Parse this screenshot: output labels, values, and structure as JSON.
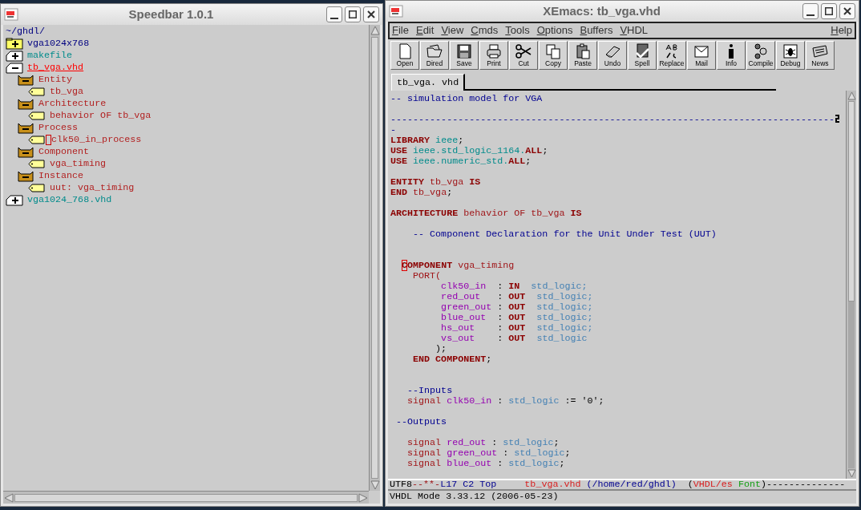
{
  "speedbar": {
    "title": "Speedbar 1.0.1",
    "path": "~/ghdl/",
    "items": [
      {
        "kind": "folder",
        "label": "vga1024x768",
        "expanded": false,
        "selected": false
      },
      {
        "kind": "file",
        "label": "makefile",
        "expanded": false,
        "selected": false
      },
      {
        "kind": "file",
        "label": "tb_vga.vhd",
        "expanded": true,
        "selected": true,
        "children": [
          {
            "kind": "group",
            "label": "Entity",
            "children": [
              {
                "kind": "tag",
                "label": "tb_vga",
                "cursor": false
              }
            ]
          },
          {
            "kind": "group",
            "label": "Architecture",
            "children": [
              {
                "kind": "tag",
                "label": "behavior OF tb_vga",
                "cursor": false
              }
            ]
          },
          {
            "kind": "group",
            "label": "Process",
            "children": [
              {
                "kind": "tag",
                "label": "clk50_in_process",
                "cursor": true
              }
            ]
          },
          {
            "kind": "group",
            "label": "Component",
            "children": [
              {
                "kind": "tag",
                "label": "vga_timing",
                "cursor": false
              }
            ]
          },
          {
            "kind": "group",
            "label": "Instance",
            "children": [
              {
                "kind": "tag",
                "label": "uut: vga_timing",
                "cursor": false
              }
            ]
          }
        ]
      },
      {
        "kind": "file",
        "label": "vga1024_768.vhd",
        "expanded": false,
        "selected": false
      }
    ]
  },
  "editor": {
    "title": "XEmacs: tb_vga.vhd",
    "menu": [
      "File",
      "Edit",
      "View",
      "Cmds",
      "Tools",
      "Options",
      "Buffers",
      "VHDL"
    ],
    "help_menu": "Help",
    "toolbar": [
      "Open",
      "Dired",
      "Save",
      "Print",
      "Cut",
      "Copy",
      "Paste",
      "Undo",
      "Spell",
      "Replace",
      "Mail",
      "Info",
      "Compile",
      "Debug",
      "News"
    ],
    "tabs": [
      {
        "label": "tb_vga. vhd",
        "selected": true
      }
    ],
    "code": [
      {
        "kind": "code",
        "segments": [
          {
            "text": "-- simulation model for VGA",
            "kind": "comment"
          }
        ]
      },
      {
        "kind": "blank"
      },
      {
        "kind": "code",
        "wrapped": true,
        "segments": [
          {
            "text": "-------------------------------------------------------------------------------",
            "kind": "comment"
          }
        ]
      },
      {
        "kind": "code",
        "segments": [
          {
            "text": "-",
            "kind": "comment"
          }
        ]
      },
      {
        "kind": "code",
        "segments": [
          {
            "text": "LIBRARY",
            "kind": "kw"
          },
          {
            "text": " ieee",
            "kind": "lib"
          },
          {
            "text": ";",
            "kind": "plain"
          }
        ]
      },
      {
        "kind": "code",
        "segments": [
          {
            "text": "USE",
            "kind": "kw"
          },
          {
            "text": " ieee.std_logic_1164.",
            "kind": "lib"
          },
          {
            "text": "ALL",
            "kind": "kw"
          },
          {
            "text": ";",
            "kind": "plain"
          }
        ]
      },
      {
        "kind": "code",
        "segments": [
          {
            "text": "USE",
            "kind": "kw"
          },
          {
            "text": " ieee.numeric_std.",
            "kind": "lib"
          },
          {
            "text": "ALL",
            "kind": "kw"
          },
          {
            "text": ";",
            "kind": "plain"
          }
        ]
      },
      {
        "kind": "blank"
      },
      {
        "kind": "code",
        "segments": [
          {
            "text": "ENTITY",
            "kind": "kw"
          },
          {
            "text": " tb_vga ",
            "kind": "id"
          },
          {
            "text": "IS",
            "kind": "kw"
          }
        ]
      },
      {
        "kind": "code",
        "segments": [
          {
            "text": "END",
            "kind": "kw"
          },
          {
            "text": " tb_vga",
            "kind": "id"
          },
          {
            "text": ";",
            "kind": "plain"
          }
        ]
      },
      {
        "kind": "blank"
      },
      {
        "kind": "code",
        "segments": [
          {
            "text": "ARCHITECTURE",
            "kind": "kw"
          },
          {
            "text": " behavior OF tb_vga ",
            "kind": "id"
          },
          {
            "text": "IS",
            "kind": "kw"
          }
        ]
      },
      {
        "kind": "blank"
      },
      {
        "kind": "code",
        "segments": [
          {
            "text": "    -- Component Declaration for the Unit Under Test (UUT)",
            "kind": "comment"
          }
        ]
      },
      {
        "kind": "blank"
      },
      {
        "kind": "blank"
      },
      {
        "kind": "code",
        "segments": [
          {
            "text": "  COMPONENT",
            "kind": "kw",
            "cursor": true
          },
          {
            "text": " vga_timing",
            "kind": "id"
          }
        ]
      },
      {
        "kind": "code",
        "segments": [
          {
            "text": "    PORT(",
            "kind": "id"
          }
        ]
      },
      {
        "kind": "code",
        "segments": [
          {
            "text": "         clk50_in",
            "kind": "sig"
          },
          {
            "text": "  : ",
            "kind": "plain"
          },
          {
            "text": "IN",
            "kind": "kw"
          },
          {
            "text": "  std_logic;",
            "kind": "type"
          }
        ]
      },
      {
        "kind": "code",
        "segments": [
          {
            "text": "         red_out",
            "kind": "sig"
          },
          {
            "text": "   : ",
            "kind": "plain"
          },
          {
            "text": "OUT",
            "kind": "kw"
          },
          {
            "text": "  std_logic;",
            "kind": "type"
          }
        ]
      },
      {
        "kind": "code",
        "segments": [
          {
            "text": "         green_out",
            "kind": "sig"
          },
          {
            "text": " : ",
            "kind": "plain"
          },
          {
            "text": "OUT",
            "kind": "kw"
          },
          {
            "text": "  std_logic;",
            "kind": "type"
          }
        ]
      },
      {
        "kind": "code",
        "segments": [
          {
            "text": "         blue_out",
            "kind": "sig"
          },
          {
            "text": "  : ",
            "kind": "plain"
          },
          {
            "text": "OUT",
            "kind": "kw"
          },
          {
            "text": "  std_logic;",
            "kind": "type"
          }
        ]
      },
      {
        "kind": "code",
        "segments": [
          {
            "text": "         hs_out",
            "kind": "sig"
          },
          {
            "text": "    : ",
            "kind": "plain"
          },
          {
            "text": "OUT",
            "kind": "kw"
          },
          {
            "text": "  std_logic;",
            "kind": "type"
          }
        ]
      },
      {
        "kind": "code",
        "segments": [
          {
            "text": "         vs_out",
            "kind": "sig"
          },
          {
            "text": "    : ",
            "kind": "plain"
          },
          {
            "text": "OUT",
            "kind": "kw"
          },
          {
            "text": "  std_logic",
            "kind": "type"
          }
        ]
      },
      {
        "kind": "code",
        "segments": [
          {
            "text": "        );",
            "kind": "plain"
          }
        ]
      },
      {
        "kind": "code",
        "segments": [
          {
            "text": "    END COMPONENT",
            "kind": "kw"
          },
          {
            "text": ";",
            "kind": "plain"
          }
        ]
      },
      {
        "kind": "blank"
      },
      {
        "kind": "blank"
      },
      {
        "kind": "code",
        "segments": [
          {
            "text": "   --Inputs",
            "kind": "comment"
          }
        ]
      },
      {
        "kind": "code",
        "segments": [
          {
            "text": "   signal",
            "kind": "id"
          },
          {
            "text": " clk50_in",
            "kind": "sig"
          },
          {
            "text": " : ",
            "kind": "plain"
          },
          {
            "text": "std_logic",
            "kind": "type"
          },
          {
            "text": " := '0';",
            "kind": "plain"
          }
        ]
      },
      {
        "kind": "blank"
      },
      {
        "kind": "code",
        "segments": [
          {
            "text": " --Outputs",
            "kind": "comment"
          }
        ]
      },
      {
        "kind": "blank"
      },
      {
        "kind": "code",
        "segments": [
          {
            "text": "   signal",
            "kind": "id"
          },
          {
            "text": " red_out",
            "kind": "sig"
          },
          {
            "text": " : ",
            "kind": "plain"
          },
          {
            "text": "std_logic",
            "kind": "type"
          },
          {
            "text": ";",
            "kind": "plain"
          }
        ]
      },
      {
        "kind": "code",
        "segments": [
          {
            "text": "   signal",
            "kind": "id"
          },
          {
            "text": " green_out",
            "kind": "sig"
          },
          {
            "text": " : ",
            "kind": "plain"
          },
          {
            "text": "std_logic",
            "kind": "type"
          },
          {
            "text": ";",
            "kind": "plain"
          }
        ]
      },
      {
        "kind": "code",
        "segments": [
          {
            "text": "   signal",
            "kind": "id"
          },
          {
            "text": " blue_out",
            "kind": "sig"
          },
          {
            "text": " : ",
            "kind": "plain"
          },
          {
            "text": "std_logic",
            "kind": "type"
          },
          {
            "text": ";",
            "kind": "plain"
          }
        ]
      }
    ],
    "modeline": [
      {
        "text": "UTF8",
        "kind": "plain"
      },
      {
        "text": "--**-",
        "kind": "id"
      },
      {
        "text": "L17 C2 Top",
        "kind": "comment"
      },
      {
        "text": "     tb_vga.vhd",
        "kind": "red"
      },
      {
        "text": " (/home/red/ghdl)",
        "kind": "comment"
      },
      {
        "text": "  (",
        "kind": "plain"
      },
      {
        "text": "VHDL/es",
        "kind": "red"
      },
      {
        "text": " Font",
        "kind": "green"
      },
      {
        "text": ")--------------",
        "kind": "plain"
      }
    ],
    "echo": "VHDL Mode 3.33.12 (2006-05-23)"
  }
}
